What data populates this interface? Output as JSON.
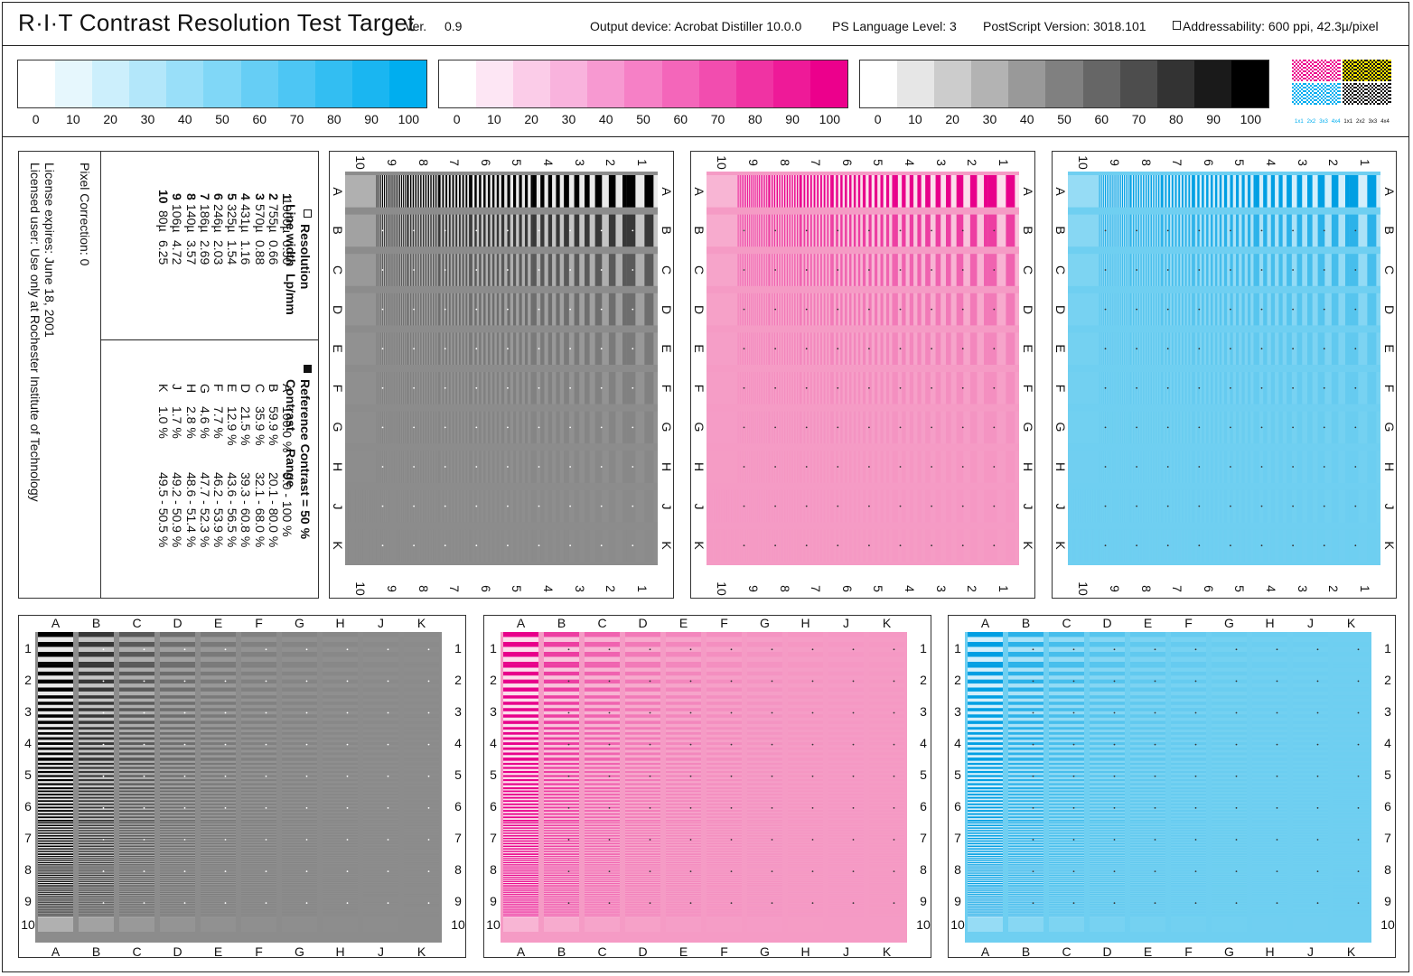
{
  "header": {
    "title": "R·I·T  Contrast Resolution Test Target",
    "ver_label": "Ver.",
    "ver_value": "0.9",
    "output_device": "Output device: Acrobat Distiller 10.0.0",
    "ps_level": "PS Language Level: 3",
    "ps_version": "PostScript Version: 3018.101",
    "addressability": "Addressability: 600 ppi, 42.3µ/pixel"
  },
  "scales": [
    {
      "name": "cyan",
      "color": "#00aeef",
      "labels": [
        "0",
        "10",
        "20",
        "30",
        "40",
        "50",
        "60",
        "70",
        "80",
        "90",
        "100"
      ]
    },
    {
      "name": "magenta",
      "color": "#ec008c",
      "labels": [
        "0",
        "10",
        "20",
        "30",
        "40",
        "50",
        "60",
        "70",
        "80",
        "90",
        "100"
      ]
    },
    {
      "name": "black",
      "color": "#000000",
      "labels": [
        "0",
        "10",
        "20",
        "30",
        "40",
        "50",
        "60",
        "70",
        "80",
        "90",
        "100"
      ]
    }
  ],
  "pixel_patch_labels": [
    "1x1",
    "2x2",
    "3x3",
    "4x4",
    "1x1",
    "2x2",
    "3x3",
    "4x4"
  ],
  "legend": {
    "pixel_correction": "Pixel Correction: 0",
    "license_expires": "License expires: June 18, 2001",
    "licensed_user": "Licensed user: Use only at Rochester Institute of Technology",
    "resolution_title": "Resolution",
    "resolution_header": "Line width  Lp/mm",
    "resolution_rows": [
      {
        "n": "1",
        "width": "1000µ",
        "lpmm": "0.50"
      },
      {
        "n": "2",
        "width": "755µ",
        "lpmm": "0.66"
      },
      {
        "n": "3",
        "width": "570µ",
        "lpmm": "0.88"
      },
      {
        "n": "4",
        "width": "431µ",
        "lpmm": "1.16"
      },
      {
        "n": "5",
        "width": "325µ",
        "lpmm": "1.54"
      },
      {
        "n": "6",
        "width": "246µ",
        "lpmm": "2.03"
      },
      {
        "n": "7",
        "width": "186µ",
        "lpmm": "2.69"
      },
      {
        "n": "8",
        "width": "140µ",
        "lpmm": "3.57"
      },
      {
        "n": "9",
        "width": "106µ",
        "lpmm": "4.72"
      },
      {
        "n": "10",
        "width": "80µ",
        "lpmm": "6.25"
      }
    ],
    "contrast_title": "Reference Contrast = 50 %",
    "contrast_header": "Contrast     Range",
    "contrast_rows": [
      {
        "k": "A",
        "contrast": "100.0 %",
        "range": "0.0 - 100 %"
      },
      {
        "k": "B",
        "contrast": "59.9 %",
        "range": "20.1 - 80.0 %"
      },
      {
        "k": "C",
        "contrast": "35.9 %",
        "range": "32.1 - 68.0 %"
      },
      {
        "k": "D",
        "contrast": "21.5 %",
        "range": "39.3 - 60.8 %"
      },
      {
        "k": "E",
        "contrast": "12.9 %",
        "range": "43.6 - 56.5 %"
      },
      {
        "k": "F",
        "contrast": "7.7 %",
        "range": "46.2 - 53.9 %"
      },
      {
        "k": "G",
        "contrast": "4.6 %",
        "range": "47.7 - 52.3 %"
      },
      {
        "k": "H",
        "contrast": "2.8 %",
        "range": "48.6 - 51.4 %"
      },
      {
        "k": "J",
        "contrast": "1.7 %",
        "range": "49.2 - 50.9 %"
      },
      {
        "k": "K",
        "contrast": "1.0 %",
        "range": "49.5 - 50.5 %"
      }
    ]
  },
  "row_letters": [
    "A",
    "B",
    "C",
    "D",
    "E",
    "F",
    "G",
    "H",
    "J",
    "K"
  ],
  "column_numbers": [
    "1",
    "2",
    "3",
    "4",
    "5",
    "6",
    "7",
    "8",
    "9",
    "10"
  ],
  "targets": [
    {
      "name": "gray",
      "base": "#8c8c8c",
      "dark": "#000000",
      "light": "#f4f4f4",
      "dot": "#ffffff"
    },
    {
      "name": "magenta",
      "base": "#f59bc5",
      "dark": "#e8008b",
      "light": "#fde6f0",
      "dot": "#333333"
    },
    {
      "name": "cyan",
      "base": "#6fcff1",
      "dark": "#009fe3",
      "light": "#dff3fc",
      "dot": "#333333"
    }
  ]
}
